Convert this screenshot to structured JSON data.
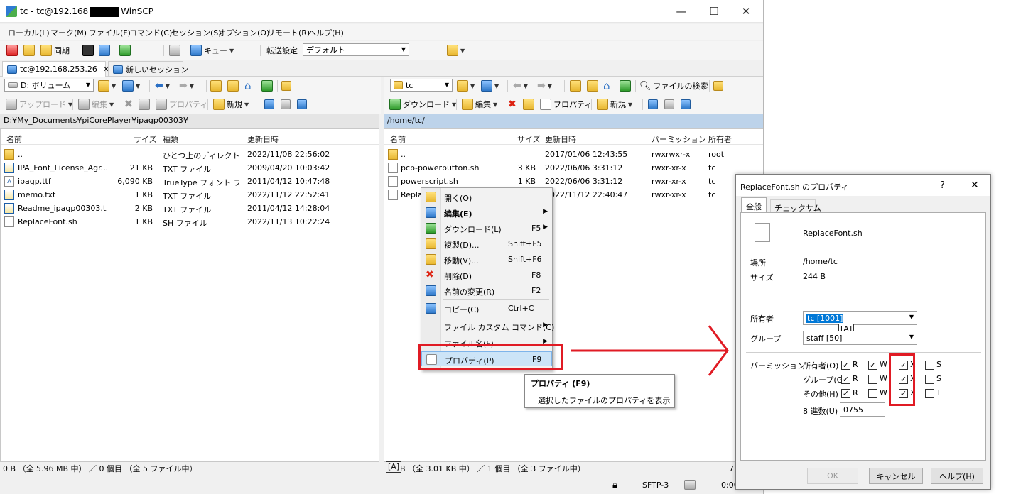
{
  "window": {
    "title_left": "tc - tc@192.168",
    "title_right": "WinSCP",
    "minimize": "—",
    "maximize": "☐",
    "close": "✕"
  },
  "menu": [
    "ローカル(L)",
    "マーク(M)",
    "ファイル(F)",
    "コマンド(C)",
    "セッション(S)",
    "オプション(O)",
    "リモート(R)",
    "ヘルプ(H)"
  ],
  "toolbar": {
    "sync": "同期",
    "queue": "キュー",
    "transfer_settings_label": "転送設定",
    "transfer_settings_value": "デフォルト"
  },
  "tabs": {
    "session": "tc@192.168.253.26",
    "session_close": "✕",
    "new_session": "新しいセッション"
  },
  "left": {
    "drive": "D: ボリューム",
    "upload": "アップロード",
    "edit": "編集",
    "properties": "プロパティ",
    "new": "新規",
    "path": "D:¥My_Documents¥piCorePlayer¥ipagp00303¥",
    "headers": {
      "name": "名前",
      "size": "サイズ",
      "type": "種類",
      "modified": "更新日時"
    },
    "rows": [
      {
        "name": "..",
        "size": "",
        "type": "ひとつ上のディレクトリ",
        "modified": "2022/11/08  22:56:02",
        "icon": "folder-up"
      },
      {
        "name": "IPA_Font_License_Agr...",
        "size": "21 KB",
        "type": "TXT ファイル",
        "modified": "2009/04/20  10:03:42",
        "icon": "text"
      },
      {
        "name": "ipagp.ttf",
        "size": "6,090 KB",
        "type": "TrueType フォント フ...",
        "modified": "2011/04/12  10:47:48",
        "icon": "font"
      },
      {
        "name": "memo.txt",
        "size": "1 KB",
        "type": "TXT ファイル",
        "modified": "2022/11/12  22:52:41",
        "icon": "text"
      },
      {
        "name": "Readme_ipagp00303.txt",
        "size": "2 KB",
        "type": "TXT ファイル",
        "modified": "2011/04/12  14:28:04",
        "icon": "text"
      },
      {
        "name": "ReplaceFont.sh",
        "size": "1 KB",
        "type": "SH ファイル",
        "modified": "2022/11/13  10:22:24",
        "icon": "file"
      }
    ],
    "status": "0 B （全 5.96 MB 中） ／ 0 個目 （全 5 ファイル中）"
  },
  "right": {
    "dir": "tc",
    "download": "ダウンロード",
    "edit": "編集",
    "properties": "プロパティ",
    "new": "新規",
    "find": "ファイルの検索",
    "path": "/home/tc/",
    "headers": {
      "name": "名前",
      "size": "サイズ",
      "modified": "更新日時",
      "perm": "パーミッション",
      "owner": "所有者"
    },
    "rows": [
      {
        "name": "..",
        "size": "",
        "modified": "2017/01/06 12:43:55",
        "perm": "rwxrwxr-x",
        "owner": "root",
        "icon": "folder-up"
      },
      {
        "name": "pcp-powerbutton.sh",
        "size": "3 KB",
        "modified": "2022/06/06 3:31:12",
        "perm": "rwxr-xr-x",
        "owner": "tc",
        "icon": "file"
      },
      {
        "name": "powerscript.sh",
        "size": "1 KB",
        "modified": "2022/06/06 3:31:12",
        "perm": "rwxr-xr-x",
        "owner": "tc",
        "icon": "file"
      },
      {
        "name": "Repla",
        "size": "",
        "modified": "2022/11/12 22:40:47",
        "perm": "rwxr-xr-x",
        "owner": "tc",
        "icon": "file"
      }
    ],
    "status_tag": "[A]",
    "status": "B （全 3.01 KB 中） ／ 1 個目 （全 3 ファイル中）",
    "status_right": "7"
  },
  "bottom": {
    "protocol": "SFTP-3",
    "time": "0:00"
  },
  "context_menu": [
    {
      "label": "開く(O)",
      "shortcut": "",
      "sub": false
    },
    {
      "label": "編集(E)",
      "shortcut": "",
      "sub": true
    },
    {
      "label": "ダウンロード(L)",
      "shortcut": "F5",
      "sub": true
    },
    {
      "label": "複製(D)...",
      "shortcut": "Shift+F5",
      "sub": false
    },
    {
      "label": "移動(V)...",
      "shortcut": "Shift+F6",
      "sub": false
    },
    {
      "label": "削除(D)",
      "shortcut": "F8",
      "sub": false
    },
    {
      "label": "名前の変更(R)",
      "shortcut": "F2",
      "sub": false
    },
    {
      "label": "コピー(C)",
      "shortcut": "Ctrl+C",
      "sub": false
    },
    {
      "label": "ファイル カスタム コマンド(C)",
      "shortcut": "",
      "sub": true
    },
    {
      "label": "ファイル名(F)",
      "shortcut": "",
      "sub": true
    },
    {
      "label": "プロパティ(P)",
      "shortcut": "F9",
      "sub": false
    }
  ],
  "tooltip": {
    "title": "プロパティ (F9)",
    "desc": "選択したファイルのプロパティを表示"
  },
  "dialog": {
    "title": "ReplaceFont.sh のプロパティ",
    "help": "?",
    "close": "✕",
    "tab_general": "全般",
    "tab_checksum": "チェックサム",
    "filename": "ReplaceFont.sh",
    "location_label": "場所",
    "location": "/home/tc",
    "size_label": "サイズ",
    "size": "244 B",
    "owner_label": "所有者",
    "owner": "tc [1001]",
    "owner_tag": "[A]",
    "group_label": "グループ",
    "group": "staff [50]",
    "perm_label": "パーミッション",
    "perm_rows": [
      {
        "label": "所有者(O)",
        "r": true,
        "w": true,
        "x": true,
        "s": "S"
      },
      {
        "label": "グループ(G)",
        "r": true,
        "w": false,
        "x": true,
        "s": "S"
      },
      {
        "label": "その他(H)",
        "r": true,
        "w": false,
        "x": true,
        "s": "T"
      }
    ],
    "perm_letters": {
      "r": "R",
      "w": "W",
      "x": "X"
    },
    "octal_label": "8 進数(U)",
    "octal": "0755",
    "ok": "OK",
    "cancel": "キャンセル",
    "helpbtn": "ヘルプ(H)"
  },
  "colors": {
    "highlight": "#e01b24",
    "selection": "#0078d7",
    "pathbar": "#bdd3ea"
  }
}
